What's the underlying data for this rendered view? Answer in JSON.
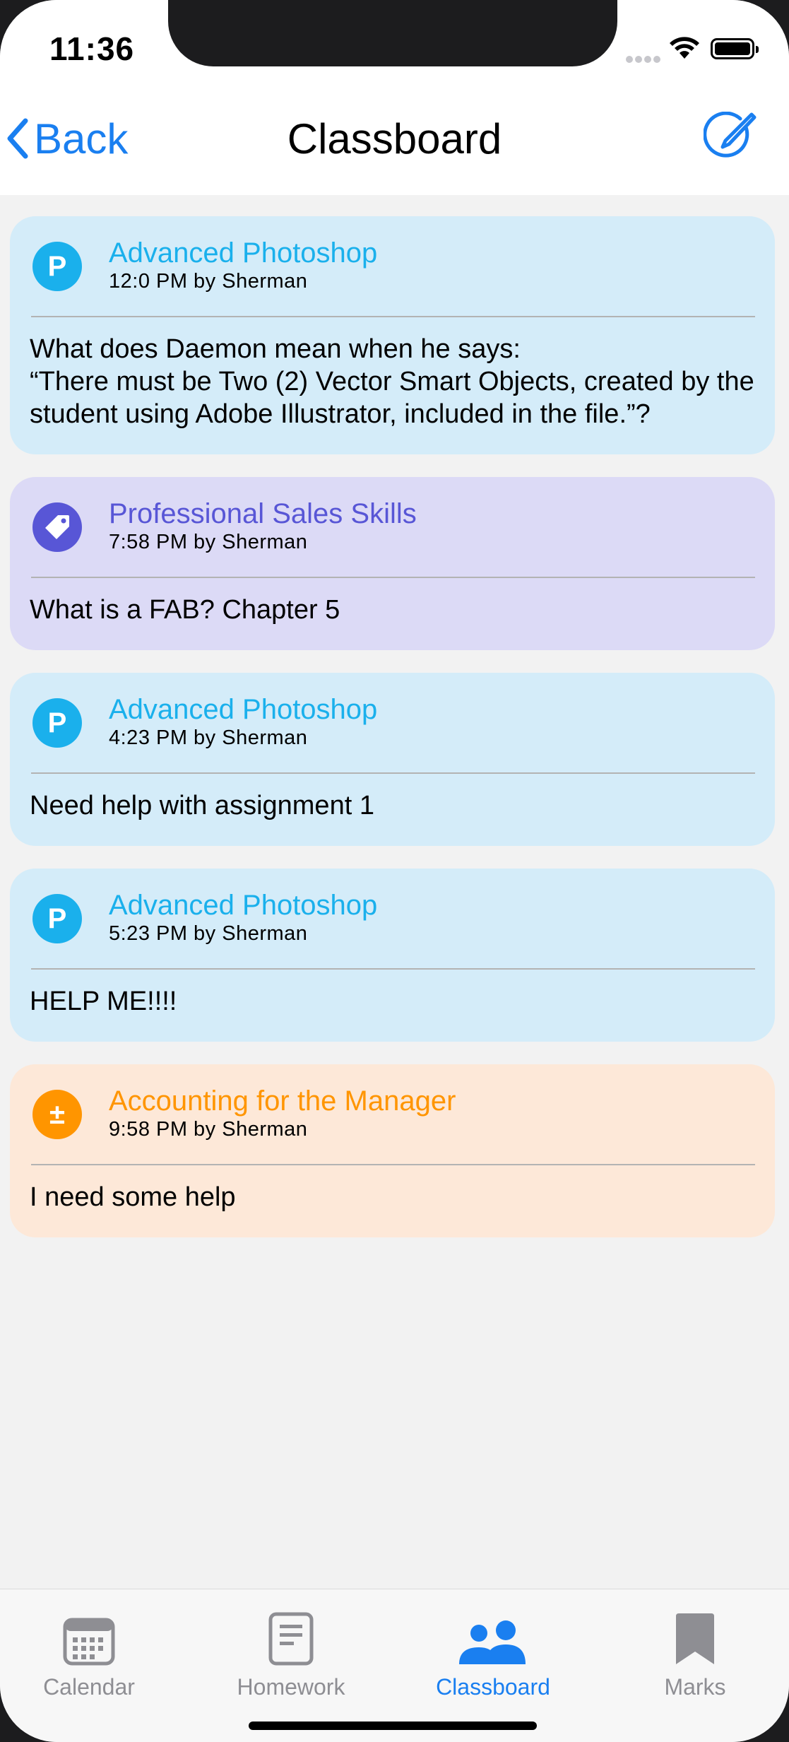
{
  "status_bar": {
    "time": "11:36"
  },
  "nav": {
    "back_label": "Back",
    "title": "Classboard",
    "compose_icon": "compose-icon"
  },
  "posts": [
    {
      "course": "Advanced Photoshop",
      "time": "12:0 PM by Sherman",
      "avatar_letter": "P",
      "icon": "letter-p-icon",
      "accent": "#1ab0ec",
      "background": "#d4ecf9",
      "body": "What does Daemon mean when he says:\n“There must be Two (2) Vector Smart Objects, created by the student using Adobe Illustrator, included in the file.”?"
    },
    {
      "course": "Professional Sales Skills",
      "time": "7:58 PM by Sherman",
      "avatar_letter": "",
      "icon": "tag-icon",
      "accent": "#5856d6",
      "background": "#dcdaf6",
      "body": "What is a FAB? Chapter 5"
    },
    {
      "course": "Advanced Photoshop",
      "time": "4:23 PM by Sherman",
      "avatar_letter": "P",
      "icon": "letter-p-icon",
      "accent": "#1ab0ec",
      "background": "#d4ecf9",
      "body": "Need help with assignment 1"
    },
    {
      "course": "Advanced Photoshop",
      "time": "5:23 PM by Sherman",
      "avatar_letter": "P",
      "icon": "letter-p-icon",
      "accent": "#1ab0ec",
      "background": "#d4ecf9",
      "body": "HELP ME!!!!"
    },
    {
      "course": "Accounting for the Manager",
      "time": "9:58 PM by Sherman",
      "avatar_letter": "±",
      "icon": "plus-minus-icon",
      "accent": "#ff9500",
      "background": "#fde8d8",
      "body": "I need some help"
    }
  ],
  "tabs": [
    {
      "label": "Calendar",
      "icon": "calendar-icon",
      "active": false
    },
    {
      "label": "Homework",
      "icon": "document-icon",
      "active": false
    },
    {
      "label": "Classboard",
      "icon": "people-icon",
      "active": true
    },
    {
      "label": "Marks",
      "icon": "bookmark-icon",
      "active": false
    }
  ],
  "colors": {
    "accent_blue": "#1a7ff0",
    "tab_inactive": "#8e8e93",
    "background": "#f2f2f2"
  }
}
